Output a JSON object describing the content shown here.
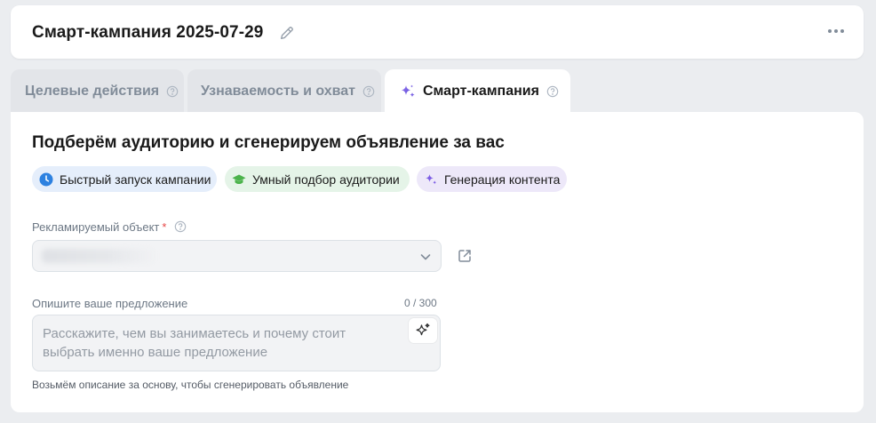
{
  "header": {
    "title": "Смарт-кампания 2025-07-29"
  },
  "tabs": [
    {
      "label": "Целевые действия",
      "active": false
    },
    {
      "label": "Узнаваемость и охват",
      "active": false
    },
    {
      "label": "Смарт-кампания",
      "active": true
    }
  ],
  "main": {
    "title": "Подберём аудиторию и сгенерируем объявление за вас",
    "chips": [
      {
        "label": "Быстрый запуск кампании",
        "icon": "clock-icon",
        "color": "#2d81e0"
      },
      {
        "label": "Умный подбор аудитории",
        "icon": "graduation-cap-icon",
        "color": "#4bb34b"
      },
      {
        "label": "Генерация контента",
        "icon": "sparkle-icon",
        "color": "#7c5de5"
      }
    ],
    "object_field": {
      "label": "Рекламируемый объект",
      "required_mark": "*"
    },
    "description_field": {
      "label": "Опишите ваше предложение",
      "counter": "0 / 300",
      "placeholder": "Расскажите, чем вы занимаетесь и почему стоит выбрать именно ваше предложение",
      "hint": "Возьмём описание за основу, чтобы сгенерировать объявление"
    }
  },
  "colors": {
    "page_bg": "#ebedf0",
    "card_bg": "#ffffff",
    "accent_purple": "#7c5de5",
    "required_red": "#e64646"
  }
}
